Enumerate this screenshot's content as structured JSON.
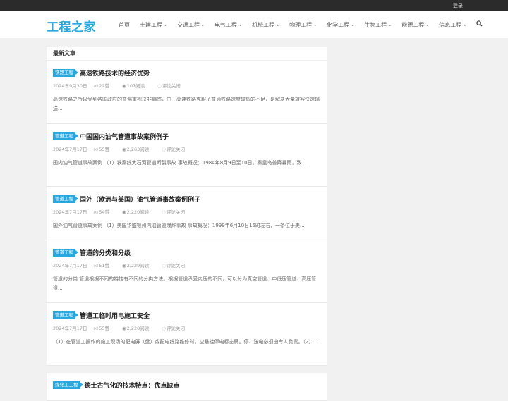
{
  "topbar": {
    "login": "登录"
  },
  "header": {
    "logo": "工程之家",
    "nav": [
      {
        "label": "首页",
        "has_dropdown": false
      },
      {
        "label": "土建工程",
        "has_dropdown": true
      },
      {
        "label": "交通工程",
        "has_dropdown": true
      },
      {
        "label": "电气工程",
        "has_dropdown": true
      },
      {
        "label": "机械工程",
        "has_dropdown": true
      },
      {
        "label": "物理工程",
        "has_dropdown": true
      },
      {
        "label": "化学工程",
        "has_dropdown": true
      },
      {
        "label": "生物工程",
        "has_dropdown": true
      },
      {
        "label": "能源工程",
        "has_dropdown": true
      },
      {
        "label": "信息工程",
        "has_dropdown": true
      }
    ],
    "search_icon": "search-icon"
  },
  "main": {
    "section_title": "最新文章",
    "posts": [
      {
        "category": "铁路工程",
        "title": "高速铁路技术的经济优势",
        "date": "2024年9月30日",
        "likes": "22赞",
        "views": "107阅读",
        "comments": "评论关闭",
        "excerpt": "高速铁路之所以受到各国政府的普遍重视决非偶然，由于高速铁路克服了普通铁路速度较低的不足，是解决大量旅客快速输送..."
      },
      {
        "category": "管道工程",
        "title": "中国国内油气管道事故案例例子",
        "date": "2024年7月17日",
        "likes": "55赞",
        "views": "2,263阅读",
        "comments": "评论关闭",
        "excerpt": "国内油气管道事故案例 （1）铁秦线大石河管道断裂事故 事故概况：1984年8月9日至10日，秦皇岛普降暴雨，致..."
      },
      {
        "category": "管道工程",
        "title": "国外（欧洲与美国）油气管道事故案例例子",
        "date": "2024年7月17日",
        "likes": "54赞",
        "views": "2,220阅读",
        "comments": "评论关闭",
        "excerpt": "国外油气管道事故案例 （1）美国华盛顿州汽油管道爆炸事故 事故概况：1999年6月10日15时左右，一条位于美..."
      },
      {
        "category": "管道工程",
        "title": "管道的分类和分级",
        "date": "2024年7月17日",
        "likes": "51赞",
        "views": "2,229阅读",
        "comments": "评论关闭",
        "excerpt": "管道的分类 管道根据不同的特性有不同的分类方法。根据管道承受内压的不同，可以分为真空管道、中低压管道、高压管道..."
      },
      {
        "category": "管道工程",
        "title": "管道工临时用电施工安全",
        "date": "2024年7月17日",
        "likes": "55赞",
        "views": "2,228阅读",
        "comments": "评论关闭",
        "excerpt": "（1）在管道工操作的施工现场的配电屏（盘）或配电线路维修时，应悬挂停电标志牌。停、送电必须由专人负责。（2）..."
      },
      {
        "category": "煤化工工程",
        "title": "德士古气化的技术特点：优点缺点",
        "date": "",
        "likes": "",
        "views": "",
        "comments": "",
        "excerpt": ""
      }
    ]
  }
}
